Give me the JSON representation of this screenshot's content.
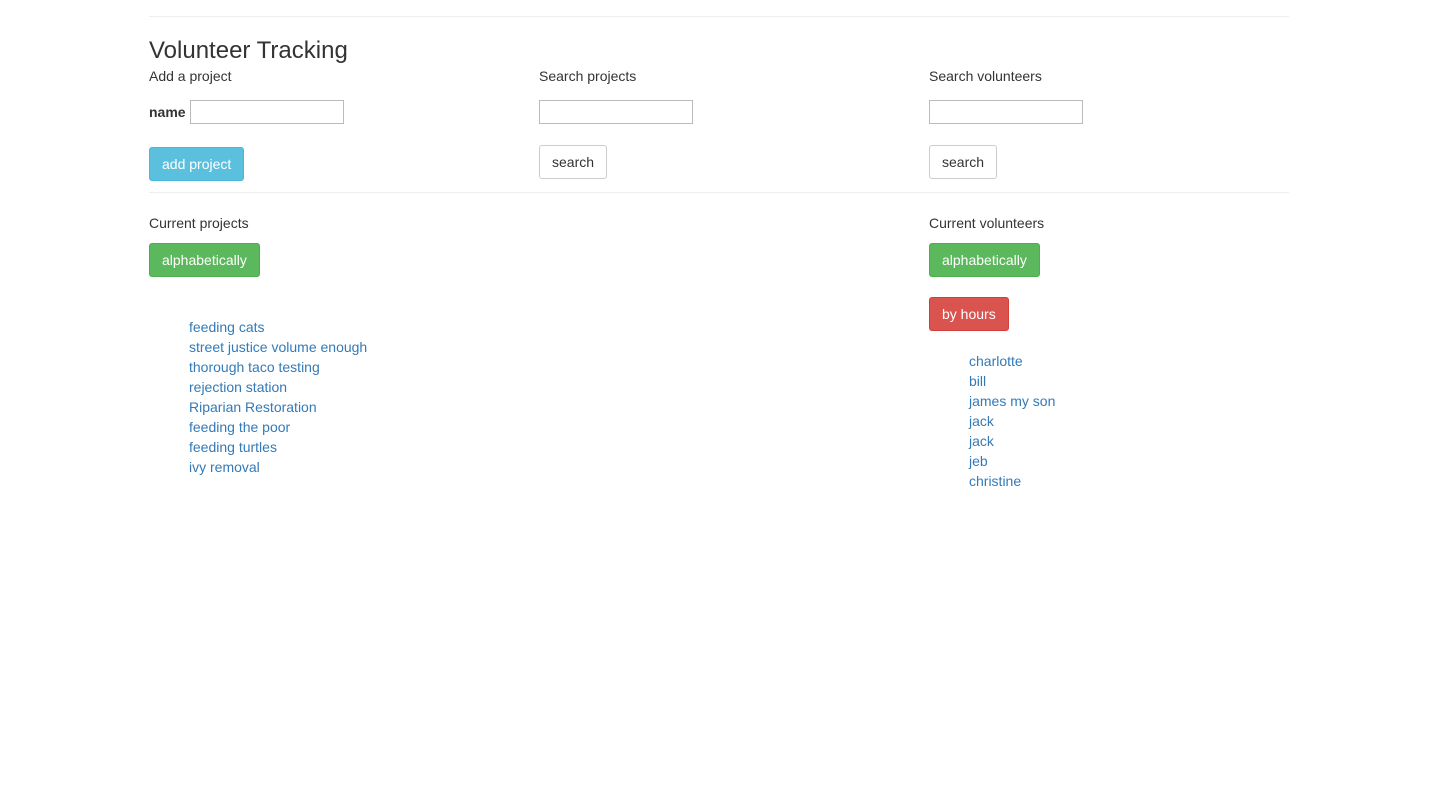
{
  "page": {
    "title": "Volunteer Tracking"
  },
  "add_project": {
    "heading": "Add a project",
    "name_label": "name",
    "name_value": "",
    "button_label": "add project"
  },
  "search_projects": {
    "heading": "Search projects",
    "value": "",
    "button_label": "search"
  },
  "search_volunteers": {
    "heading": "Search volunteers",
    "value": "",
    "button_label": "search"
  },
  "current_projects": {
    "heading": "Current projects",
    "sort_alpha_label": "alphabetically",
    "items": [
      "feeding cats",
      "street justice volume enough",
      "thorough taco testing",
      "rejection station",
      "Riparian Restoration",
      "feeding the poor",
      "feeding turtles",
      "ivy removal"
    ]
  },
  "current_volunteers": {
    "heading": "Current volunteers",
    "sort_alpha_label": "alphabetically",
    "sort_hours_label": "by hours",
    "items": [
      "charlotte",
      "bill",
      "james my son",
      "jack",
      "jack",
      "jeb",
      "christine"
    ]
  },
  "colors": {
    "info": "#5bc0de",
    "success": "#5cb85c",
    "danger": "#d9534f",
    "link": "#337ab7"
  }
}
